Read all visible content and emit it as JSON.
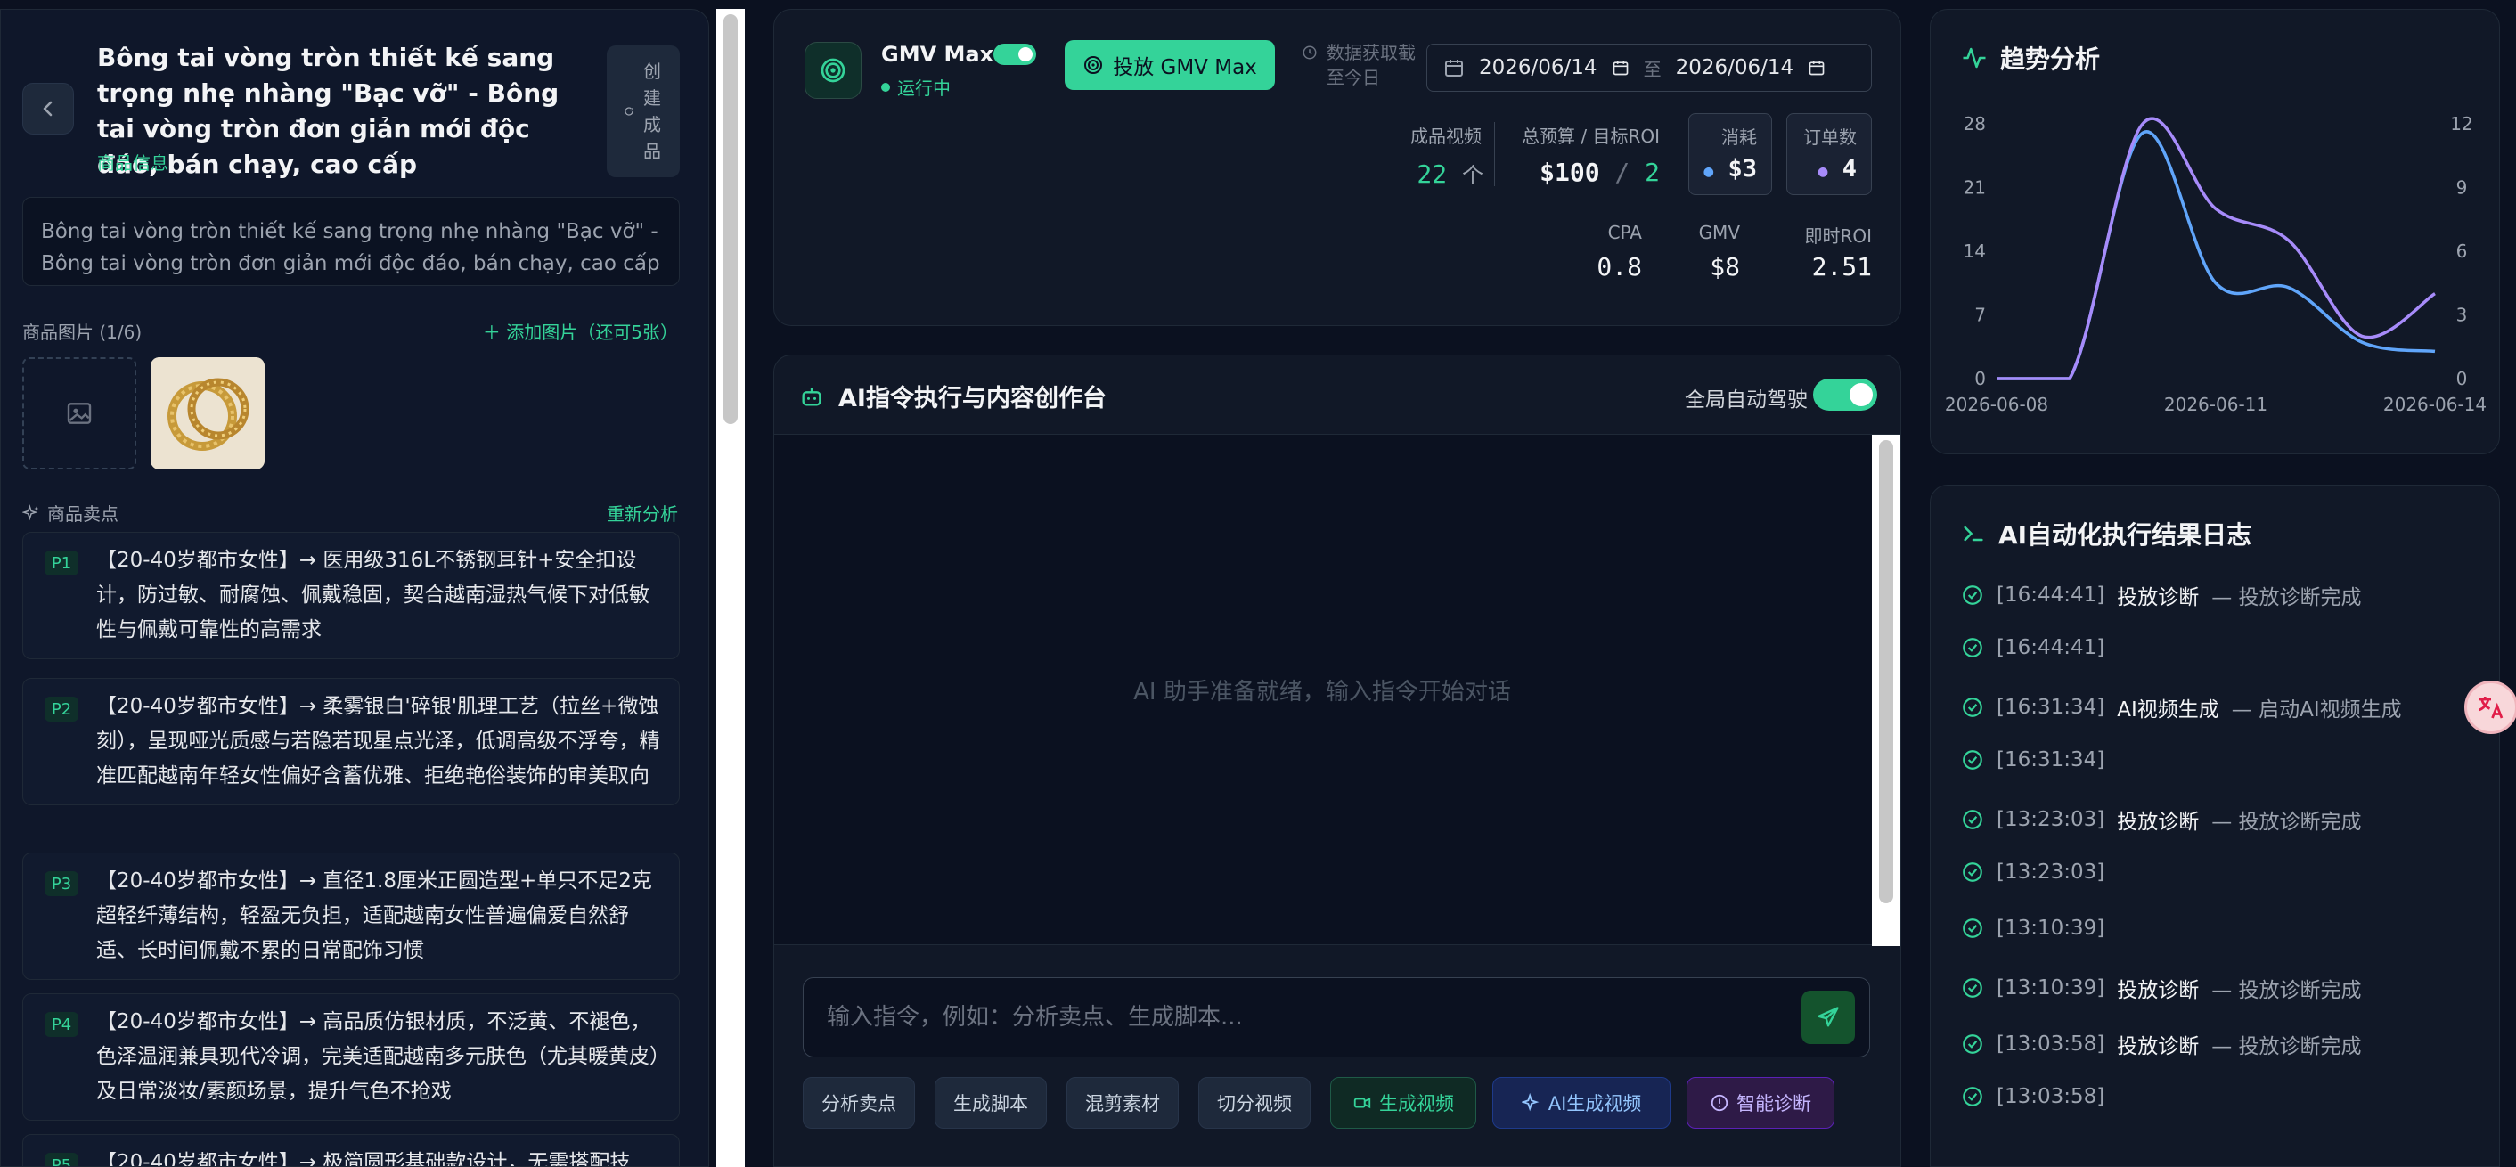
{
  "product": {
    "title": "Bông tai vòng tròn thiết kế sang trọng nhẹ nhàng \"Bạc vỡ\" - Bông tai vòng tròn đơn giản mới độc đáo, bán chạy, cao cấp",
    "subtitle": "商品信息",
    "create_button": "创建成品",
    "description": "Bông tai vòng tròn thiết kế sang trọng nhẹ nhàng \"Bạc vỡ\" - Bông tai vòng tròn đơn giản mới độc đáo, bán chạy, cao cấp",
    "images_label": "商品图片 (1/6)",
    "add_image": "添加图片（还可5张）",
    "selling_points_label": "商品卖点",
    "reanalyze": "重新分析",
    "selling_points": [
      {
        "tag": "P1",
        "text": "【20-40岁都市女性】→ 医用级316L不锈钢耳针+安全扣设计，防过敏、耐腐蚀、佩戴稳固，契合越南湿热气候下对低敏性与佩戴可靠性的高需求"
      },
      {
        "tag": "P2",
        "text": "【20-40岁都市女性】→ 柔雾银白'碎银'肌理工艺（拉丝+微蚀刻），呈现哑光质感与若隐若现星点光泽，低调高级不浮夸，精准匹配越南年轻女性偏好含蓄优雅、拒绝艳俗装饰的审美取向"
      },
      {
        "tag": "P3",
        "text": "【20-40岁都市女性】→ 直径1.8厘米正圆造型+单只不足2克超轻纤薄结构，轻盈无负担，适配越南女性普遍偏爱自然舒适、长时间佩戴不累的日常配饰习惯"
      },
      {
        "tag": "P4",
        "text": "【20-40岁都市女性】→ 高品质仿银材质，不泛黄、不褪色，色泽温润兼具现代冷调，完美适配越南多元肤色（尤其暖黄皮）及日常淡妆/素颜场景，提升气色不抢戏"
      },
      {
        "tag": "P5",
        "text": "【20-40岁都市女性】→ 极简圆形基础款设计，无需搭配技"
      }
    ]
  },
  "gmv": {
    "name": "GMV Max",
    "status": "运行中",
    "launch_button": "投放 GMV Max",
    "fetch_label_1": "数据获取截",
    "fetch_label_2": "至今日",
    "date_from": "2026/06/14",
    "date_sep": "至",
    "date_to": "2026/06/14",
    "videos_label": "成品视频",
    "videos_value": "22",
    "videos_unit": "个",
    "budget_label": "总预算 / 目标ROI",
    "budget_value": "$100",
    "budget_sep": "/",
    "roi_target": "2",
    "spend_label": "消耗",
    "spend_value": "$3",
    "orders_label": "订单数",
    "orders_value": "4",
    "cpa_label": "CPA",
    "cpa_value": "0.8",
    "gmv_label": "GMV",
    "gmv_value": "$8",
    "roi_label": "即时ROI",
    "roi_value": "2.51"
  },
  "ai": {
    "title": "AI指令执行与内容创作台",
    "auto_label": "全局自动驾驶",
    "empty_text": "AI 助手准备就绪，输入指令开始对话",
    "input_placeholder": "输入指令，例如：分析卖点、生成脚本...",
    "quick_actions": [
      "分析卖点",
      "生成脚本",
      "混剪素材",
      "切分视频",
      "生成视频",
      "AI生成视频",
      "智能诊断"
    ]
  },
  "trend": {
    "title": "趋势分析"
  },
  "chart_data": {
    "type": "line",
    "x": [
      "2026-06-08",
      "2026-06-09",
      "2026-06-10",
      "2026-06-11",
      "2026-06-12",
      "2026-06-13",
      "2026-06-14"
    ],
    "x_ticks": [
      "2026-06-08",
      "2026-06-11",
      "2026-06-14"
    ],
    "y_left_ticks": [
      0,
      7,
      14,
      21,
      28
    ],
    "y_right_ticks": [
      0,
      3,
      6,
      9,
      12
    ],
    "ylim_left": [
      0,
      28
    ],
    "ylim_right": [
      0,
      12
    ],
    "series": [
      {
        "axis": "left",
        "color": "#60a5fa",
        "values": [
          0,
          0,
          27,
          10.5,
          10,
          4,
          3
        ]
      },
      {
        "axis": "right",
        "color": "#a78bfa",
        "values": [
          0,
          0,
          12,
          8,
          6.5,
          2,
          4
        ]
      }
    ],
    "grid": false,
    "legend": "none"
  },
  "log": {
    "title": "AI自动化执行结果日志",
    "entries": [
      {
        "time": "[16:44:41]",
        "action": "投放诊断",
        "detail": "— 投放诊断完成"
      },
      {
        "time": "[16:44:41]",
        "action": "",
        "detail": ""
      },
      {
        "time": "[16:31:34]",
        "action": "AI视频生成",
        "detail": "— 启动AI视频生成"
      },
      {
        "time": "[16:31:34]",
        "action": "",
        "detail": ""
      },
      {
        "time": "[13:23:03]",
        "action": "投放诊断",
        "detail": "— 投放诊断完成"
      },
      {
        "time": "[13:23:03]",
        "action": "",
        "detail": ""
      },
      {
        "time": "[13:10:39]",
        "action": "",
        "detail": ""
      },
      {
        "time": "[13:10:39]",
        "action": "投放诊断",
        "detail": "— 投放诊断完成"
      },
      {
        "time": "[13:03:58]",
        "action": "投放诊断",
        "detail": "— 投放诊断完成"
      },
      {
        "time": "[13:03:58]",
        "action": "",
        "detail": ""
      }
    ]
  },
  "colors": {
    "accent": "#34d399",
    "blue": "#60a5fa",
    "purple": "#a78bfa",
    "panel": "#111827",
    "background": "#0b1120"
  },
  "icons": {
    "back": "chevron-left-icon",
    "create": "refresh-icon",
    "image_placeholder": "image-icon",
    "sparkle": "sparkle-icon",
    "target": "target-icon",
    "clock": "clock-icon",
    "calendar": "calendar-icon",
    "bot": "bot-icon",
    "send": "send-icon",
    "trend": "activity-icon",
    "terminal": "terminal-icon",
    "check": "check-circle-icon",
    "translate": "translate-icon"
  }
}
